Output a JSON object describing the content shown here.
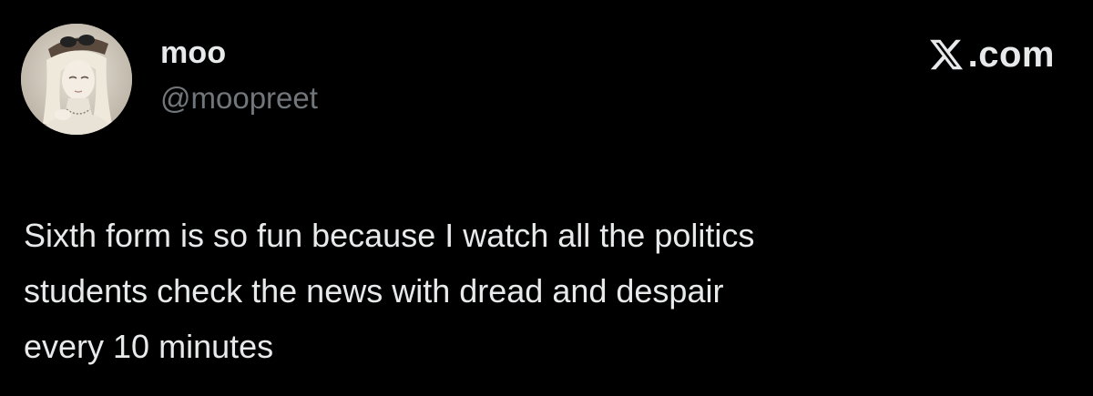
{
  "author": {
    "display_name": "moo",
    "handle": "@moopreet",
    "avatar_icon": "profile-avatar-illustration"
  },
  "brand": {
    "icon": "x-logo-icon",
    "text": ".com"
  },
  "tweet": {
    "text": "Sixth form is so fun because I watch all the politics\nstudents check the news with dread and despair\nevery 10 minutes"
  },
  "colors": {
    "background": "#000000",
    "primary_text": "#e7e9ea",
    "secondary_text": "#71767b"
  }
}
